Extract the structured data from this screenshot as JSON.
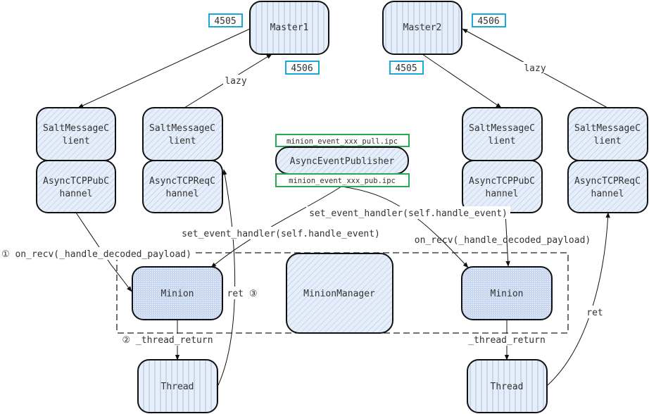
{
  "colors": {
    "fill": "#e6eefa",
    "stripe": "#a9bfe3",
    "dot_fill": "#c3d4ef",
    "border": "#111111",
    "port_border": "#1aa8dc",
    "ipc_border": "#22aa55",
    "text": "#333333"
  },
  "nodes": {
    "master1": "Master1",
    "master2": "Master2",
    "smc_l1": [
      "SaltMessageC",
      "lient"
    ],
    "pub_l1": [
      "AsyncTCPPubC",
      "hannel"
    ],
    "smc_l2": [
      "SaltMessageC",
      "lient"
    ],
    "req_l2": [
      "AsyncTCPReqC",
      "hannel"
    ],
    "smc_r1": [
      "SaltMessageC",
      "lient"
    ],
    "pub_r1": [
      "AsyncTCPPubC",
      "hannel"
    ],
    "smc_r2": [
      "SaltMessageC",
      "lient"
    ],
    "req_r2": [
      "AsyncTCPReqC",
      "hannel"
    ],
    "publisher": "AsyncEventPublisher",
    "minion_left": "Minion",
    "minion_right": "Minion",
    "manager": "MinionManager",
    "thread_left": "Thread",
    "thread_right": "Thread"
  },
  "ports": {
    "m1_pub": "4505",
    "m1_req": "4506",
    "m2_pub": "4505",
    "m2_req": "4506"
  },
  "ipc": {
    "pull": "minion_event_xxx_pull.ipc",
    "pub": "minion_event_xxx_pub.ipc"
  },
  "labels": {
    "lazy_left": "lazy",
    "lazy_right": "lazy",
    "on_recv_left": "① on_recv(_handle_decoded_payload)",
    "on_recv_right": "on_recv(_handle_decoded_payload)",
    "set_handler_left": "set_event_handler(self.handle_event)",
    "set_handler_right": "set_event_handler(self.handle_event)",
    "thread_return_left": "② _thread_return",
    "thread_return_right": "_thread_return",
    "ret_left": "ret ③",
    "ret_right": "ret"
  }
}
